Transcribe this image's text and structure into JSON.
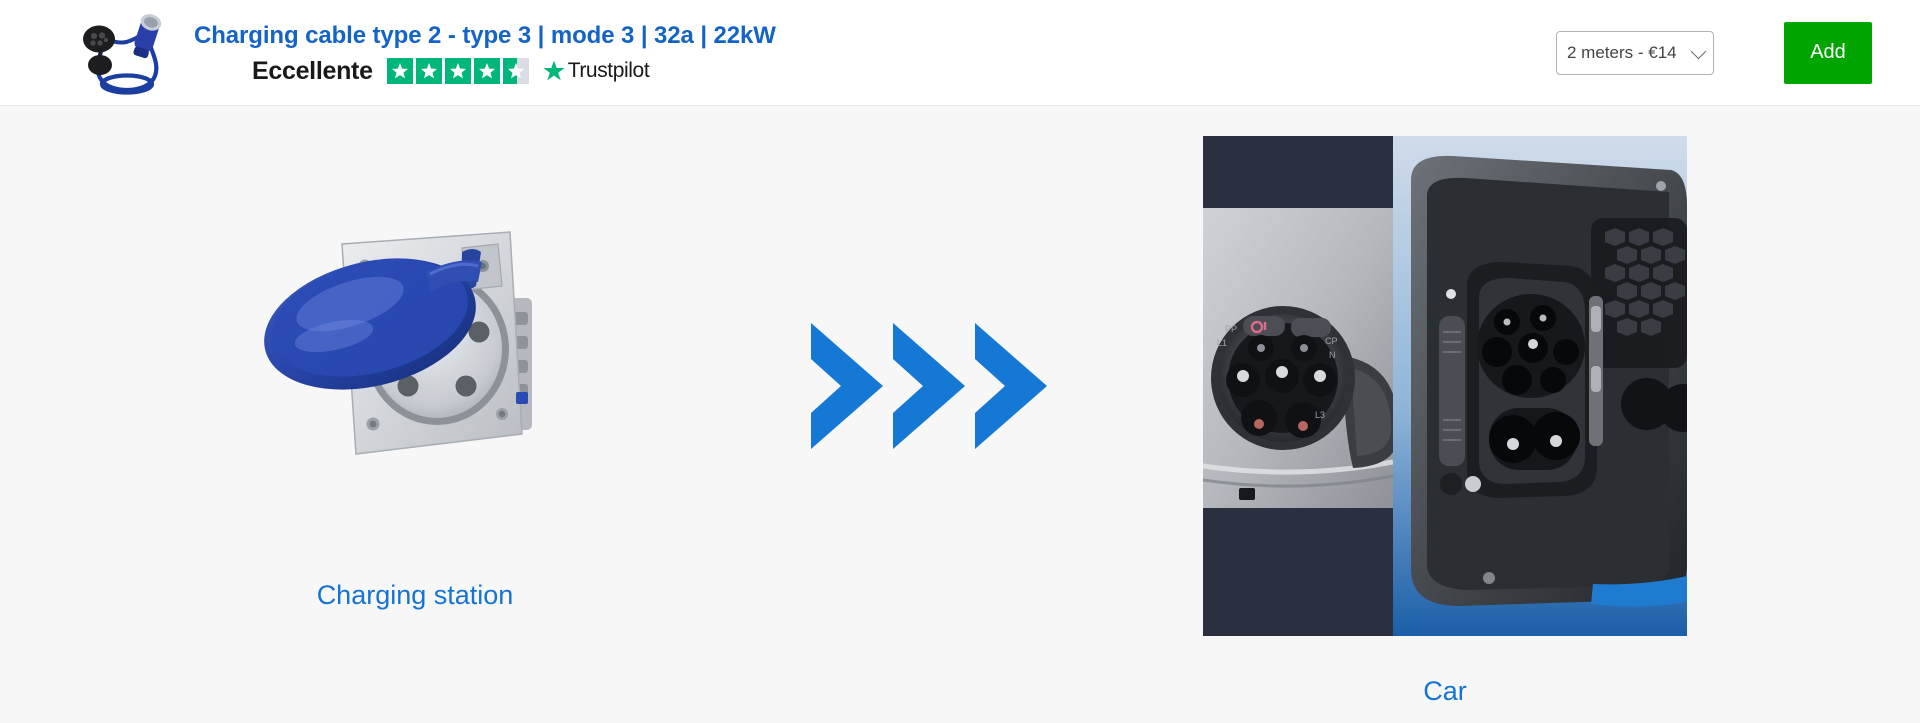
{
  "header": {
    "logo_alt": "charging-cable-product-logo",
    "product_title": "Charging cable type 2 - type 3 | mode 3 | 32a | 22kW",
    "trustpilot": {
      "rating_word": "Eccellente",
      "brand_name": "Trustpilot",
      "stars_total": 5,
      "stars_filled": 4.5,
      "star_color": "#00b67a",
      "star_empty_color": "#dcdce6"
    },
    "length_select": {
      "selected_label": "2 meters - €14",
      "options": [
        "2 meters - €14"
      ]
    },
    "add_button_label": "Add"
  },
  "main": {
    "left": {
      "caption": "Charging station",
      "image_alt": "blue-industrial-socket-with-lid"
    },
    "middle": {
      "arrow_count": 3,
      "arrow_color": "#1478d4",
      "icon": "triple-chevron-right-icon"
    },
    "right": {
      "caption": "Car",
      "image_alt": "car-charging-port-type2-and-ccs-combo"
    }
  },
  "colors": {
    "title_blue": "#1464c8",
    "caption_blue": "#1573d6",
    "accent_green": "#00a500",
    "page_background": "#f7f7f7",
    "header_background": "#ffffff"
  }
}
